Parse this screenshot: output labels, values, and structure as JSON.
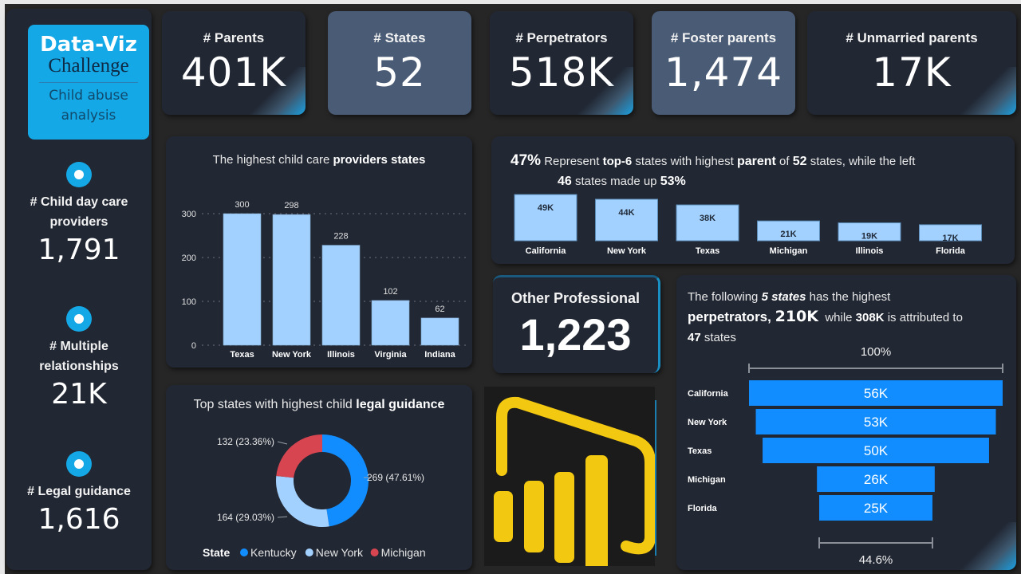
{
  "sidebar": {
    "logo_title": "Data-Viz",
    "logo_subtitle": "Challenge",
    "logo_desc_line1": "Child abuse",
    "logo_desc_line2": "analysis",
    "kpis": [
      {
        "label_line1": "# Child day care",
        "label_line2": "providers",
        "value": "1,791",
        "icon": "circle-dot-icon"
      },
      {
        "label_line1": "# Multiple",
        "label_line2": "relationships",
        "value": "21K",
        "icon": "circle-dot-icon"
      },
      {
        "label_line1": "# Legal guidance",
        "label_line2": "",
        "value": "1,616",
        "icon": "circle-dot-icon"
      }
    ]
  },
  "top_kpis": [
    {
      "label": "# Parents",
      "value": "401K"
    },
    {
      "label": "# States",
      "value": "52"
    },
    {
      "label": "# Perpetrators",
      "value": "518K"
    },
    {
      "label": "# Foster parents",
      "value": "1,474"
    },
    {
      "label": "# Unmarried parents",
      "value": "17K"
    }
  ],
  "other_professional": {
    "label": "Other Professional",
    "value": "1,223"
  },
  "colors": {
    "accent": "#14a8e6",
    "bar_light": "#a3d1ff",
    "bar_blue": "#118dff",
    "michigan_red": "#d64550",
    "card_bg": "#212733",
    "slate": "#4a5b75",
    "powerbi_yellow": "#f2c811"
  },
  "chart_data": [
    {
      "id": "providers",
      "type": "bar",
      "title_plain": "The highest child care ",
      "title_bold": "providers states",
      "categories": [
        "Texas",
        "New York",
        "Illinois",
        "Virginia",
        "Indiana"
      ],
      "values": [
        300,
        298,
        228,
        102,
        62
      ],
      "data_labels": [
        "300",
        "298",
        "228",
        "102",
        "62"
      ],
      "yticks": [
        0,
        100,
        200,
        300
      ],
      "ylim": [
        0,
        300
      ],
      "grid": true,
      "xlabel": "",
      "ylabel": ""
    },
    {
      "id": "parents",
      "type": "bar",
      "headline": {
        "p1_bold": "47%",
        "p2": " Represent ",
        "p3_bold": "top-6",
        "p4": " states with highest ",
        "p5_bold": "parent",
        "p6": " of ",
        "p7_bold": "52",
        "p8": " states, while the left",
        "line2_bold1": "46",
        "line2_text": " states made up ",
        "line2_bold2": "53%"
      },
      "categories": [
        "California",
        "New York",
        "Texas",
        "Michigan",
        "Illinois",
        "Florida"
      ],
      "values": [
        49000,
        44000,
        38000,
        21000,
        19000,
        17000
      ],
      "data_labels": [
        "49K",
        "44K",
        "38K",
        "21K",
        "19K",
        "17K"
      ],
      "ylim": [
        0,
        49000
      ],
      "grid": false
    },
    {
      "id": "legal",
      "type": "pie",
      "title_plain": "Top states with highest child ",
      "title_bold": "legal guidance",
      "legend_title": "State",
      "legend_position": "bottom",
      "slices": [
        {
          "name": "Kentucky",
          "value": 269,
          "label": "269 (47.61%)",
          "color": "#118dff"
        },
        {
          "name": "New York",
          "value": 164,
          "label": "164 (29.03%)",
          "color": "#a3d1ff"
        },
        {
          "name": "Michigan",
          "value": 132,
          "label": "132 (23.36%)",
          "color": "#d64550"
        }
      ]
    },
    {
      "id": "perpetrators",
      "type": "bar",
      "subtype": "funnel",
      "headline": {
        "l1a": "The following ",
        "l1b_bold": "5 states",
        "l1c": " has the highest",
        "l2a_bold": "perpetrators, ",
        "l2b_bold": "210K",
        "l2c": "  while ",
        "l2d_bold": "308K",
        "l2e": " is attributed to",
        "l3a_bold": "47",
        "l3b": " states"
      },
      "categories": [
        "California",
        "New York",
        "Texas",
        "Michigan",
        "Florida"
      ],
      "values": [
        56000,
        53000,
        50000,
        26000,
        25000
      ],
      "data_labels": [
        "56K",
        "53K",
        "50K",
        "26K",
        "25K"
      ],
      "top_percent": "100%",
      "bottom_percent": "44.6%"
    }
  ]
}
